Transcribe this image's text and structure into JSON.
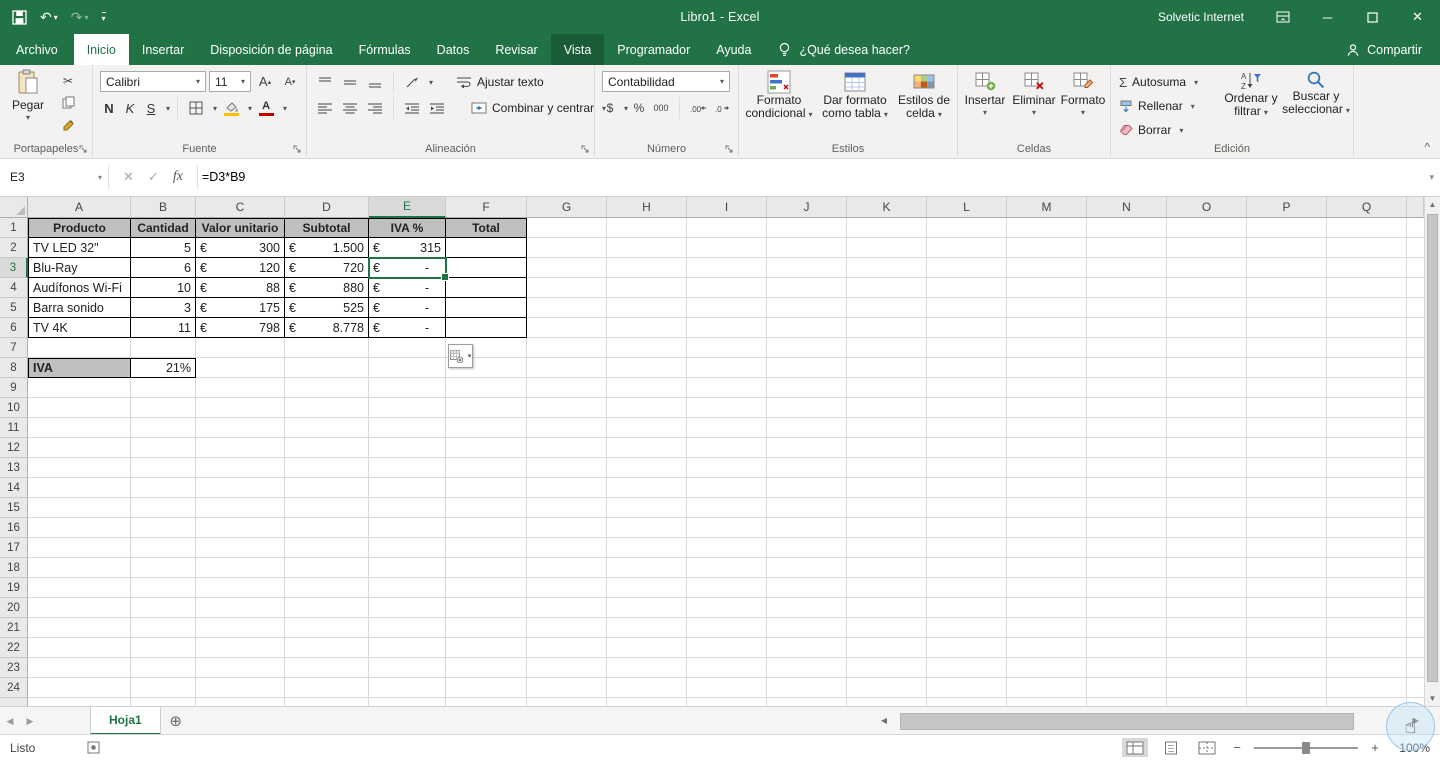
{
  "colors": {
    "excel_green": "#217346",
    "dark_green_highlight": "#1a5c38",
    "table_header_gray": "#bfbfbf",
    "font_color_bar": "#c00000",
    "fill_color_bar": "#ffc000"
  },
  "titlebar": {
    "title": "Libro1 - Excel",
    "user": "Solvetic Internet"
  },
  "menu": {
    "tabs": [
      {
        "label": "Archivo"
      },
      {
        "label": "Inicio"
      },
      {
        "label": "Insertar"
      },
      {
        "label": "Disposición de página"
      },
      {
        "label": "Fórmulas"
      },
      {
        "label": "Datos"
      },
      {
        "label": "Revisar"
      },
      {
        "label": "Vista"
      },
      {
        "label": "Programador"
      },
      {
        "label": "Ayuda"
      }
    ],
    "search_label": "¿Qué desea hacer?",
    "share": "Compartir"
  },
  "ribbon": {
    "paste": "Pegar",
    "font_name": "Calibri",
    "font_size": "11",
    "bold": "N",
    "italic": "K",
    "underline": "S",
    "wrap_text": "Ajustar texto",
    "merge_center": "Combinar y centrar",
    "number_format": "Contabilidad",
    "currency_symbol": "$",
    "percent": "%",
    "thousands": "000",
    "conditional_line1": "Formato",
    "conditional_line2": "condicional",
    "format_table_line1": "Dar formato",
    "format_table_line2": "como tabla",
    "cell_styles_line1": "Estilos de",
    "cell_styles_line2": "celda",
    "insert": "Insertar",
    "delete": "Eliminar",
    "format": "Formato",
    "autosum": "Autosuma",
    "fill": "Rellenar",
    "clear": "Borrar",
    "sort_line1": "Ordenar y",
    "sort_line2": "filtrar",
    "find_line1": "Buscar y",
    "find_line2": "seleccionar",
    "groups": {
      "clipboard": "Portapapeles",
      "font": "Fuente",
      "alignment": "Alineación",
      "number": "Número",
      "styles": "Estilos",
      "cells": "Celdas",
      "editing": "Edición"
    }
  },
  "formula_bar": {
    "name_box": "E3",
    "formula": "=D3*B9",
    "fx": "fx"
  },
  "grid": {
    "columns": [
      "A",
      "B",
      "C",
      "D",
      "E",
      "F",
      "G",
      "H",
      "I",
      "J",
      "K",
      "L",
      "M",
      "N",
      "O",
      "P",
      "Q"
    ],
    "row_count": 24,
    "selected_column": "E",
    "selected_row": 3,
    "selected_cell": "E3"
  },
  "sheet": {
    "table": {
      "currency": "€",
      "headers": [
        "Producto",
        "Cantidad",
        "Valor unitario",
        "Subtotal",
        "IVA %",
        "Total"
      ],
      "rows": [
        {
          "producto": "TV LED 32\"",
          "cantidad": "5",
          "valor_unitario": "300",
          "subtotal": "1.500",
          "iva": "315"
        },
        {
          "producto": "Blu-Ray",
          "cantidad": "6",
          "valor_unitario": "120",
          "subtotal": "720",
          "iva": "-"
        },
        {
          "producto": "Audífonos Wi-Fi",
          "cantidad": "10",
          "valor_unitario": "88",
          "subtotal": "880",
          "iva": "-"
        },
        {
          "producto": "Barra sonido",
          "cantidad": "3",
          "valor_unitario": "175",
          "subtotal": "525",
          "iva": "-"
        },
        {
          "producto": "TV 4K",
          "cantidad": "11",
          "valor_unitario": "798",
          "subtotal": "8.778",
          "iva": "-"
        }
      ]
    },
    "iva": {
      "label": "IVA",
      "value": "21%"
    },
    "tab_name": "Hoja1"
  },
  "status_bar": {
    "status": "Listo",
    "zoom": "100%"
  }
}
